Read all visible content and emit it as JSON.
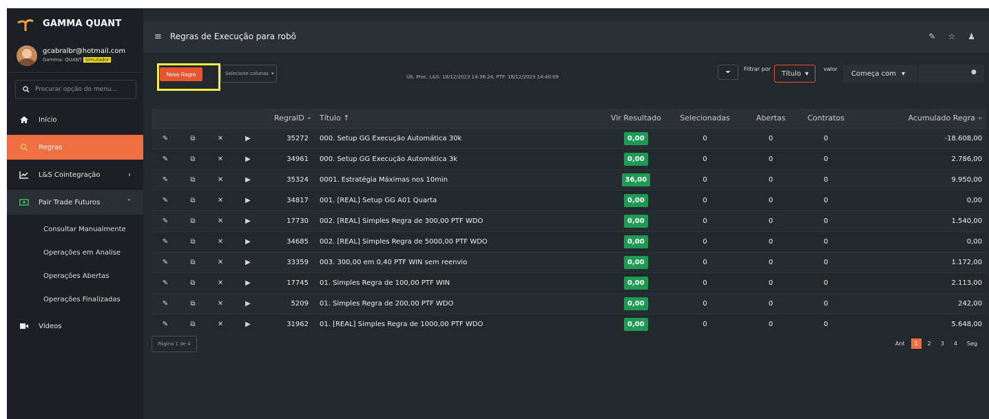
{
  "brand": {
    "name": "GAMMA QUANT"
  },
  "user": {
    "email": "gcabralbr@hotmail.com",
    "plan": "Gamma: QUANT",
    "mode": "Simulador"
  },
  "sidebar": {
    "search_placeholder": "Procurar opção do menu...",
    "items": [
      {
        "label": "Início"
      },
      {
        "label": "Regras"
      },
      {
        "label": "L&S Cointegração"
      },
      {
        "label": "Pair Trade Futuros"
      }
    ],
    "subitems": [
      {
        "label": "Consultar Manualmente"
      },
      {
        "label": "Operações em Analise"
      },
      {
        "label": "Operações Abertas"
      },
      {
        "label": "Operações Finalizadas"
      }
    ],
    "videos": "Vídeos"
  },
  "header": {
    "title": "Regras de Execução para robô"
  },
  "toolbar": {
    "new_rule": "Nova Regra",
    "select_columns": "Selecione colunas",
    "proc_info": "Últ. Proc. L&S: 18/12/2023 14:36:24, PTF: 18/12/2023 14:40:09",
    "filter_label": "Filtrar por",
    "filter_field": "Título",
    "value_label": "valor",
    "value_mode": "Começa com"
  },
  "table": {
    "columns": [
      "RegraID",
      "Título",
      "Vlr Resultado",
      "Selecionadas",
      "Abertas",
      "Contratos",
      "Acumulado Regra"
    ],
    "rows": [
      {
        "id": "35272",
        "titulo": "000. Setup GG Execução Automática 30k",
        "resultado": "0,00",
        "selecionadas": "0",
        "abertas": "0",
        "contratos": "0",
        "acumulado": "-18.608,00"
      },
      {
        "id": "34961",
        "titulo": "000. Setup GG Execução Automática 3k",
        "resultado": "0,00",
        "selecionadas": "0",
        "abertas": "0",
        "contratos": "0",
        "acumulado": "2.786,00"
      },
      {
        "id": "35324",
        "titulo": "0001. Estratégia Máximas nos 10min",
        "resultado": "36,00",
        "selecionadas": "0",
        "abertas": "0",
        "contratos": "0",
        "acumulado": "9.950,00"
      },
      {
        "id": "34817",
        "titulo": "001. [REAL] Setup GG A01 Quarta",
        "resultado": "0,00",
        "selecionadas": "0",
        "abertas": "0",
        "contratos": "0",
        "acumulado": "0,00"
      },
      {
        "id": "17730",
        "titulo": "002. [REAL] Simples Regra de 300,00 PTF WDO",
        "resultado": "0,00",
        "selecionadas": "0",
        "abertas": "0",
        "contratos": "0",
        "acumulado": "1.540,00"
      },
      {
        "id": "34685",
        "titulo": "002. [REAL] Simples Regra de 5000,00 PTF WDO",
        "resultado": "0,00",
        "selecionadas": "0",
        "abertas": "0",
        "contratos": "0",
        "acumulado": "0,00"
      },
      {
        "id": "33359",
        "titulo": "003. 300,00 em 0,40 PTF WIN sem reenvio",
        "resultado": "0,00",
        "selecionadas": "0",
        "abertas": "0",
        "contratos": "0",
        "acumulado": "1.172,00"
      },
      {
        "id": "17745",
        "titulo": "01. Simples Regra de 100,00 PTF WIN",
        "resultado": "0,00",
        "selecionadas": "0",
        "abertas": "0",
        "contratos": "0",
        "acumulado": "2.113,00"
      },
      {
        "id": "5209",
        "titulo": "01. Simples Regra de 200,00 PTF WDO",
        "resultado": "0,00",
        "selecionadas": "0",
        "abertas": "0",
        "contratos": "0",
        "acumulado": "242,00"
      },
      {
        "id": "31962",
        "titulo": "01. [REAL] Simples Regra de 1000,00 PTF WDO",
        "resultado": "0,00",
        "selecionadas": "0",
        "abertas": "0",
        "contratos": "0",
        "acumulado": "5.648,00"
      }
    ]
  },
  "pagination": {
    "info": "Página 1 de 4",
    "prev": "Ant",
    "pages": [
      "1",
      "2",
      "3",
      "4"
    ],
    "next": "Seg"
  },
  "colors": {
    "accent": "#ef6e42",
    "highlight": "#f5ee4a",
    "result_green": "#1e9a55"
  }
}
